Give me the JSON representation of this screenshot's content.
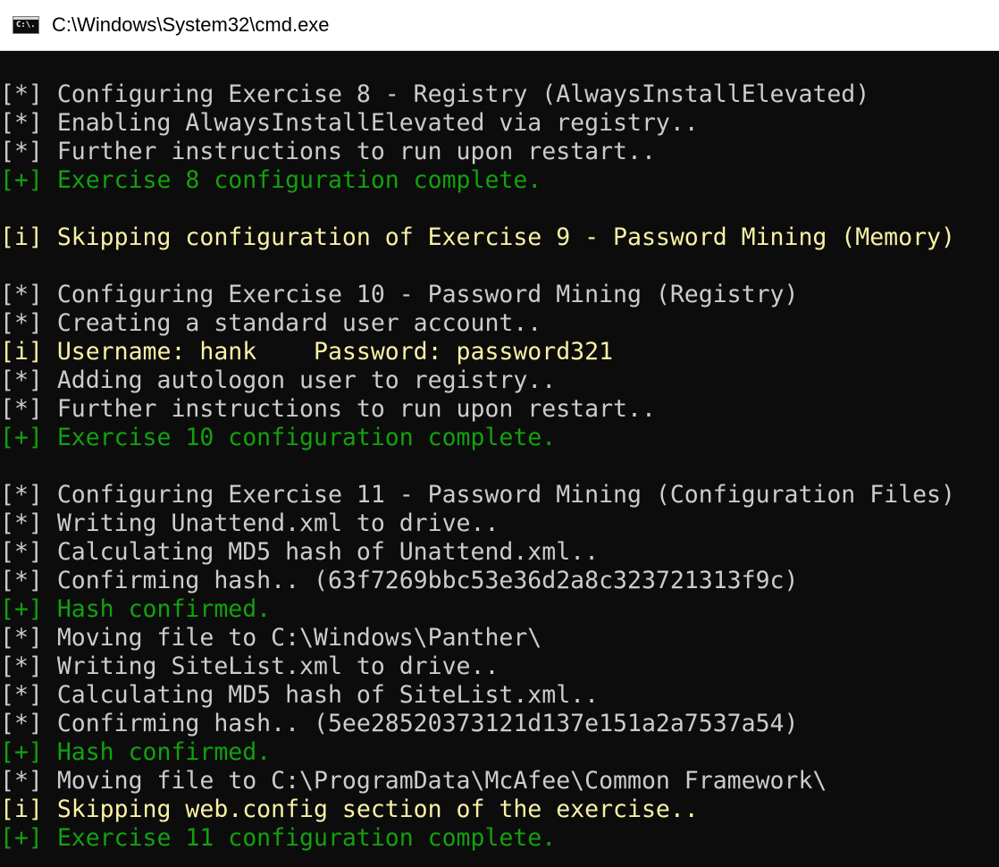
{
  "window": {
    "title": "C:\\Windows\\System32\\cmd.exe",
    "icon": "cmd-console-icon",
    "icon_text": "C:\\."
  },
  "colors": {
    "background": "#0c0c0c",
    "normal_text": "#cccccc",
    "success_text": "#13a10e",
    "info_text": "#f9f1a5",
    "titlebar": "#ffffff"
  },
  "console": {
    "lines": [
      {
        "type": "normal",
        "text": "[*] Configuring Exercise 8 - Registry (AlwaysInstallElevated)"
      },
      {
        "type": "normal",
        "text": "[*] Enabling AlwaysInstallElevated via registry.."
      },
      {
        "type": "normal",
        "text": "[*] Further instructions to run upon restart.."
      },
      {
        "type": "success",
        "text": "[+] Exercise 8 configuration complete."
      },
      {
        "type": "blank",
        "text": ""
      },
      {
        "type": "info",
        "text": "[i] Skipping configuration of Exercise 9 - Password Mining (Memory)"
      },
      {
        "type": "blank",
        "text": ""
      },
      {
        "type": "normal",
        "text": "[*] Configuring Exercise 10 - Password Mining (Registry)"
      },
      {
        "type": "normal",
        "text": "[*] Creating a standard user account.."
      },
      {
        "type": "info",
        "text": "[i] Username: hank    Password: password321"
      },
      {
        "type": "normal",
        "text": "[*] Adding autologon user to registry.."
      },
      {
        "type": "normal",
        "text": "[*] Further instructions to run upon restart.."
      },
      {
        "type": "success",
        "text": "[+] Exercise 10 configuration complete."
      },
      {
        "type": "blank",
        "text": ""
      },
      {
        "type": "normal",
        "text": "[*] Configuring Exercise 11 - Password Mining (Configuration Files)"
      },
      {
        "type": "normal",
        "text": "[*] Writing Unattend.xml to drive.."
      },
      {
        "type": "normal",
        "text": "[*] Calculating MD5 hash of Unattend.xml.."
      },
      {
        "type": "normal",
        "text": "[*] Confirming hash.. (63f7269bbc53e36d2a8c323721313f9c)"
      },
      {
        "type": "success",
        "text": "[+] Hash confirmed."
      },
      {
        "type": "normal",
        "text": "[*] Moving file to C:\\Windows\\Panther\\"
      },
      {
        "type": "normal",
        "text": "[*] Writing SiteList.xml to drive.."
      },
      {
        "type": "normal",
        "text": "[*] Calculating MD5 hash of SiteList.xml.."
      },
      {
        "type": "normal",
        "text": "[*] Confirming hash.. (5ee28520373121d137e151a2a7537a54)"
      },
      {
        "type": "success",
        "text": "[+] Hash confirmed."
      },
      {
        "type": "normal",
        "text": "[*] Moving file to C:\\ProgramData\\McAfee\\Common Framework\\"
      },
      {
        "type": "info",
        "text": "[i] Skipping web.config section of the exercise.."
      },
      {
        "type": "success",
        "text": "[+] Exercise 11 configuration complete."
      }
    ]
  }
}
